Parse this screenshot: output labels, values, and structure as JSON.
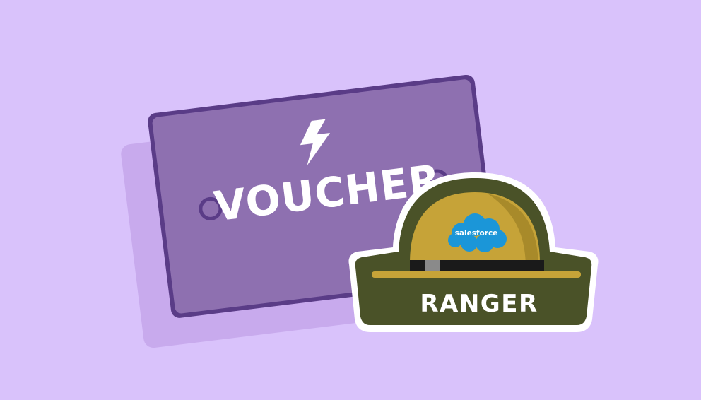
{
  "illustration": {
    "background_color": "#d9c2fb",
    "voucher": {
      "label": "VOUCHER",
      "icon": "lightning-bolt-icon",
      "card_color": "#8e70b0",
      "border_color": "#5a3c87",
      "shadow_color": "#c8aaed"
    },
    "badge": {
      "label": "RANGER",
      "brand_logo_text": "salesforce",
      "icon": "ranger-hat-icon",
      "hat_color": "#c6a338",
      "band_color": "#4a5228",
      "cloud_color": "#1b96d8"
    }
  }
}
